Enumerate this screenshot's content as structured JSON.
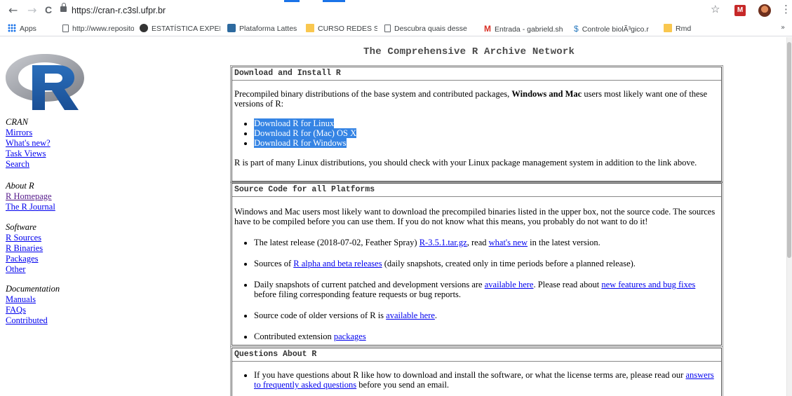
{
  "browser": {
    "back": "←",
    "forward": "→",
    "reload": "C",
    "url": "https://cran-r.c3sl.ufpr.br",
    "star": "☆",
    "ext_label": "M",
    "menu": "⋮",
    "more": "»",
    "bookmarks": [
      {
        "label": "Apps",
        "icon": "apps-grid-icon"
      },
      {
        "label": "http://www.repositor",
        "icon": "document-icon"
      },
      {
        "label": "ESTATÍSTICA EXPERIM",
        "icon": "globe-icon"
      },
      {
        "label": "Plataforma Lattes",
        "icon": "lattes-icon"
      },
      {
        "label": "CURSO REDES SOCIA",
        "icon": "folder-icon"
      },
      {
        "label": "Descubra quais desse",
        "icon": "document-icon"
      },
      {
        "label": "Entrada - gabrield.sh",
        "icon": "gmail-icon"
      },
      {
        "label": "Controle biolÃ³gico.r",
        "icon": "swirl-icon"
      },
      {
        "label": "Rmd",
        "icon": "folder-icon"
      }
    ]
  },
  "page": {
    "title": "The Comprehensive R Archive Network",
    "sidebar": [
      {
        "heading": "CRAN",
        "links": [
          "Mirrors",
          "What's new?",
          "Task Views",
          "Search"
        ]
      },
      {
        "heading": "About R",
        "links": [
          "R Homepage",
          "The R Journal"
        ]
      },
      {
        "heading": "Software",
        "links": [
          "R Sources",
          "R Binaries",
          "Packages",
          "Other"
        ]
      },
      {
        "heading": "Documentation",
        "links": [
          "Manuals",
          "FAQs",
          "Contributed"
        ]
      }
    ],
    "download": {
      "title": "Download and Install R",
      "intro_a": "Precompiled binary distributions of the base system and contributed packages, ",
      "intro_bold": "Windows and Mac",
      "intro_b": " users most likely want one of these versions of R:",
      "links": [
        "Download R for Linux",
        "Download R for (Mac) OS X",
        "Download R for Windows"
      ],
      "outro": "R is part of many Linux distributions, you should check with your Linux package management system in addition to the link above."
    },
    "source": {
      "title": "Source Code for all Platforms",
      "intro": "Windows and Mac users most likely want to download the precompiled binaries listed in the upper box, not the source code. The sources have to be compiled before you can use them. If you do not know what this means, you probably do not want to do it!",
      "latest_a": "The latest release (2018-07-02, Feather Spray) ",
      "latest_link1": "R-3.5.1.tar.gz",
      "latest_b": ", read ",
      "latest_link2": "what's new",
      "latest_c": " in the latest version.",
      "alpha_a": "Sources of ",
      "alpha_link": "R alpha and beta releases",
      "alpha_b": " (daily snapshots, created only in time periods before a planned release).",
      "daily_a": "Daily snapshots of current patched and development versions are ",
      "daily_link1": "available here",
      "daily_b": ". Please read about ",
      "daily_link2": "new features and bug fixes",
      "daily_c": " before filing corresponding feature requests or bug reports.",
      "older_a": "Source code of older versions of R is ",
      "older_link": "available here",
      "older_b": ".",
      "contrib_a": "Contributed extension ",
      "contrib_link": "packages"
    },
    "questions": {
      "title": "Questions About R",
      "item_a": "If you have questions about R like how to download and install the software, or what the license terms are, please read our ",
      "item_link": "answers to frequently asked questions",
      "item_b": " before you send an email."
    }
  }
}
